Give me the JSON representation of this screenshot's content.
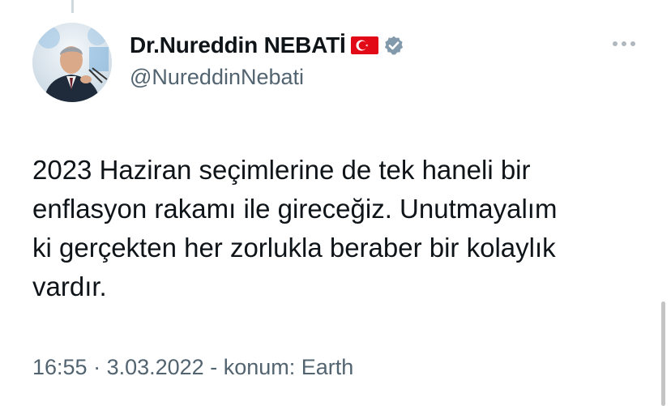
{
  "tweet": {
    "author": {
      "display_name": "Dr.Nureddin NEBATİ",
      "handle": "@NureddinNebati",
      "flag_icon": "turkey-flag-icon",
      "verified_icon": "verified-badge-icon",
      "avatar_icon": "profile-avatar"
    },
    "more_icon": "more-options-icon",
    "text_lines": [
      "2023 Haziran seçimlerine de tek haneli bir",
      "enflasyon rakamı ile gireceğiz. Unutmayalım",
      "ki gerçekten her zorlukla beraber bir kolaylık",
      "vardır."
    ],
    "meta": {
      "time": "16:55",
      "separator": " · ",
      "date": "3.03.2022",
      "location": " - konum: Earth"
    }
  },
  "colors": {
    "text_primary": "#0f1419",
    "text_secondary": "#536471",
    "verified_badge": "#829aab",
    "flag_red": "#e30a17"
  }
}
